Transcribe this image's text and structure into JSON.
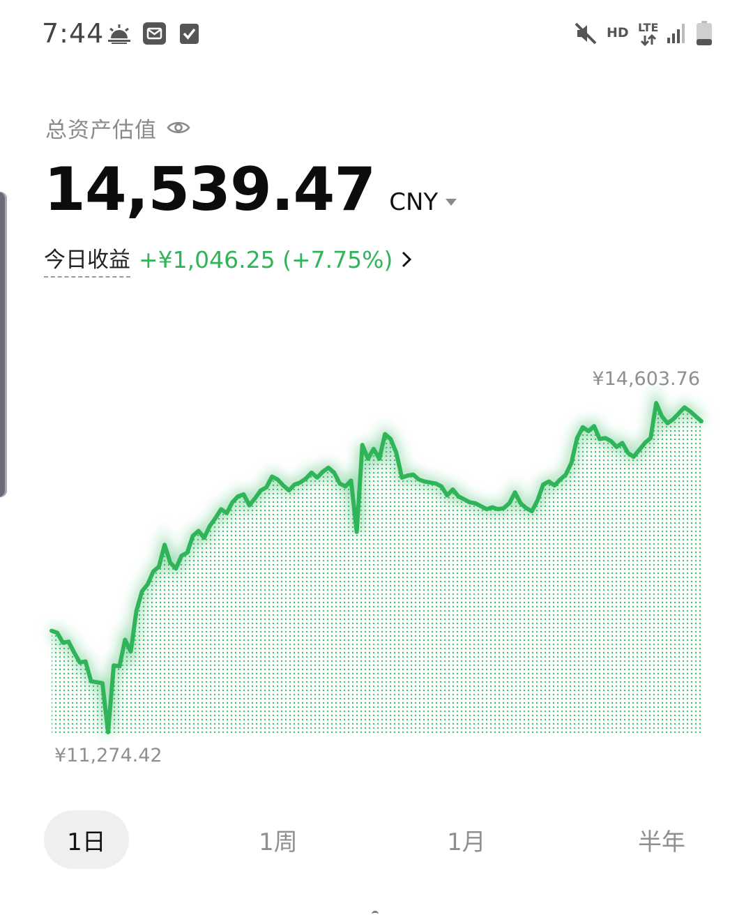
{
  "status_bar": {
    "time": "7:44",
    "network_hd": "HD",
    "network_lte": "LTE",
    "icons": [
      "weather-sunrise-icon",
      "mail-icon",
      "checkbox-icon",
      "mute-icon",
      "lte-icon",
      "signal-icon",
      "battery-icon"
    ]
  },
  "asset": {
    "label": "总资产估值",
    "total_value": "14,539.47",
    "currency": "CNY",
    "pnl_label": "今日收益",
    "pnl_value": "+¥1,046.25 (+7.75%)"
  },
  "colors": {
    "accent_green": "#2fb45a",
    "muted_text": "#8f8f8f",
    "active_tab_bg": "#efefef"
  },
  "chart_data": {
    "type": "area",
    "max_label": "¥14,603.76",
    "min_label": "¥11,274.42",
    "ylim": [
      11274.42,
      14603.76
    ],
    "values": [
      12300,
      12280,
      12180,
      12190,
      12080,
      11980,
      11990,
      11790,
      11780,
      11770,
      11274.42,
      11950,
      11940,
      12210,
      12090,
      12500,
      12700,
      12770,
      12900,
      12950,
      13170,
      12990,
      12930,
      13060,
      13090,
      13260,
      13310,
      13240,
      13360,
      13440,
      13530,
      13490,
      13600,
      13660,
      13680,
      13570,
      13640,
      13720,
      13750,
      13860,
      13830,
      13770,
      13720,
      13780,
      13800,
      13840,
      13900,
      13850,
      13910,
      13950,
      13900,
      13790,
      13760,
      13820,
      13300,
      14180,
      14040,
      14140,
      14040,
      14290,
      14240,
      14100,
      13850,
      13870,
      13880,
      13830,
      13810,
      13800,
      13790,
      13760,
      13670,
      13730,
      13660,
      13630,
      13600,
      13590,
      13560,
      13530,
      13550,
      13530,
      13540,
      13590,
      13700,
      13590,
      13540,
      13510,
      13620,
      13780,
      13810,
      13770,
      13830,
      13880,
      14000,
      14250,
      14360,
      14320,
      14370,
      14240,
      14250,
      14220,
      14160,
      14200,
      14100,
      14060,
      14130,
      14200,
      14250,
      14603.76,
      14470,
      14400,
      14440,
      14500,
      14560,
      14520,
      14470,
      14420
    ]
  },
  "range_tabs": [
    {
      "label": "1日",
      "active": true
    },
    {
      "label": "1周",
      "active": false
    },
    {
      "label": "1月",
      "active": false
    },
    {
      "label": "半年",
      "active": false
    }
  ]
}
